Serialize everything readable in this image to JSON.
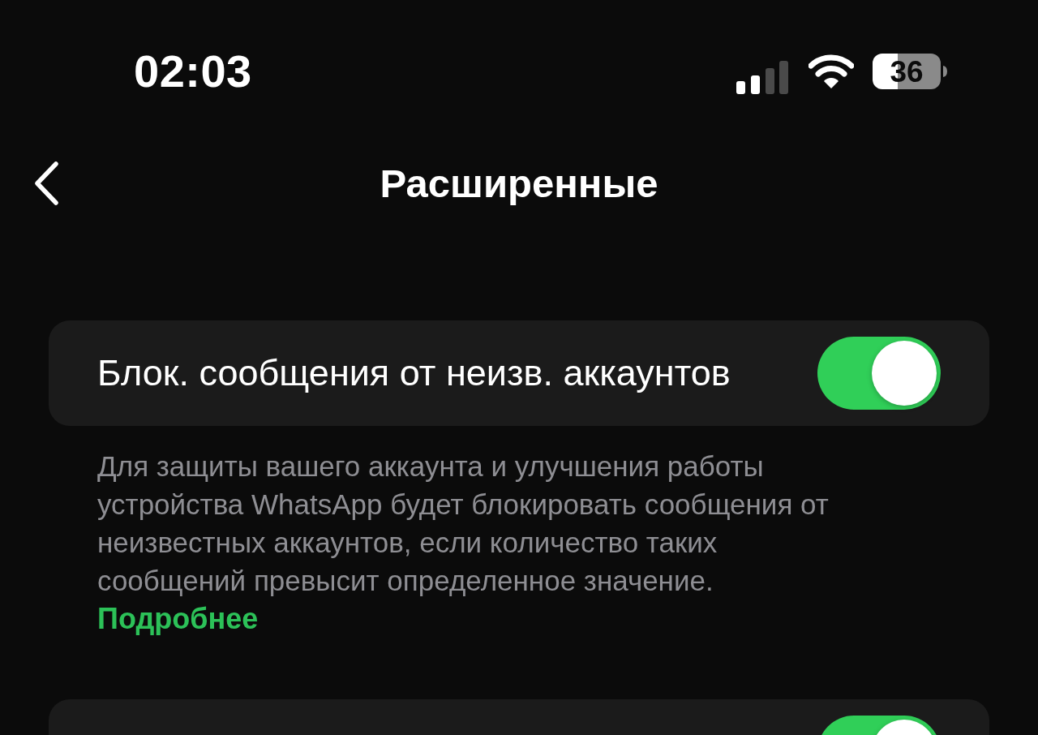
{
  "status_bar": {
    "time": "02:03",
    "battery": "36"
  },
  "header": {
    "title": "Расширенные"
  },
  "settings": [
    {
      "label": "Блок. сообщения от неизв. аккаунтов",
      "on": true,
      "description": "Для защиты вашего аккаунта и улучшения работы устройства WhatsApp будет блокировать сообщения от неизвестных аккаунтов, если количество таких сообщений превысит определенное значение.",
      "link": "Подробнее"
    },
    {
      "on": true
    }
  ]
}
